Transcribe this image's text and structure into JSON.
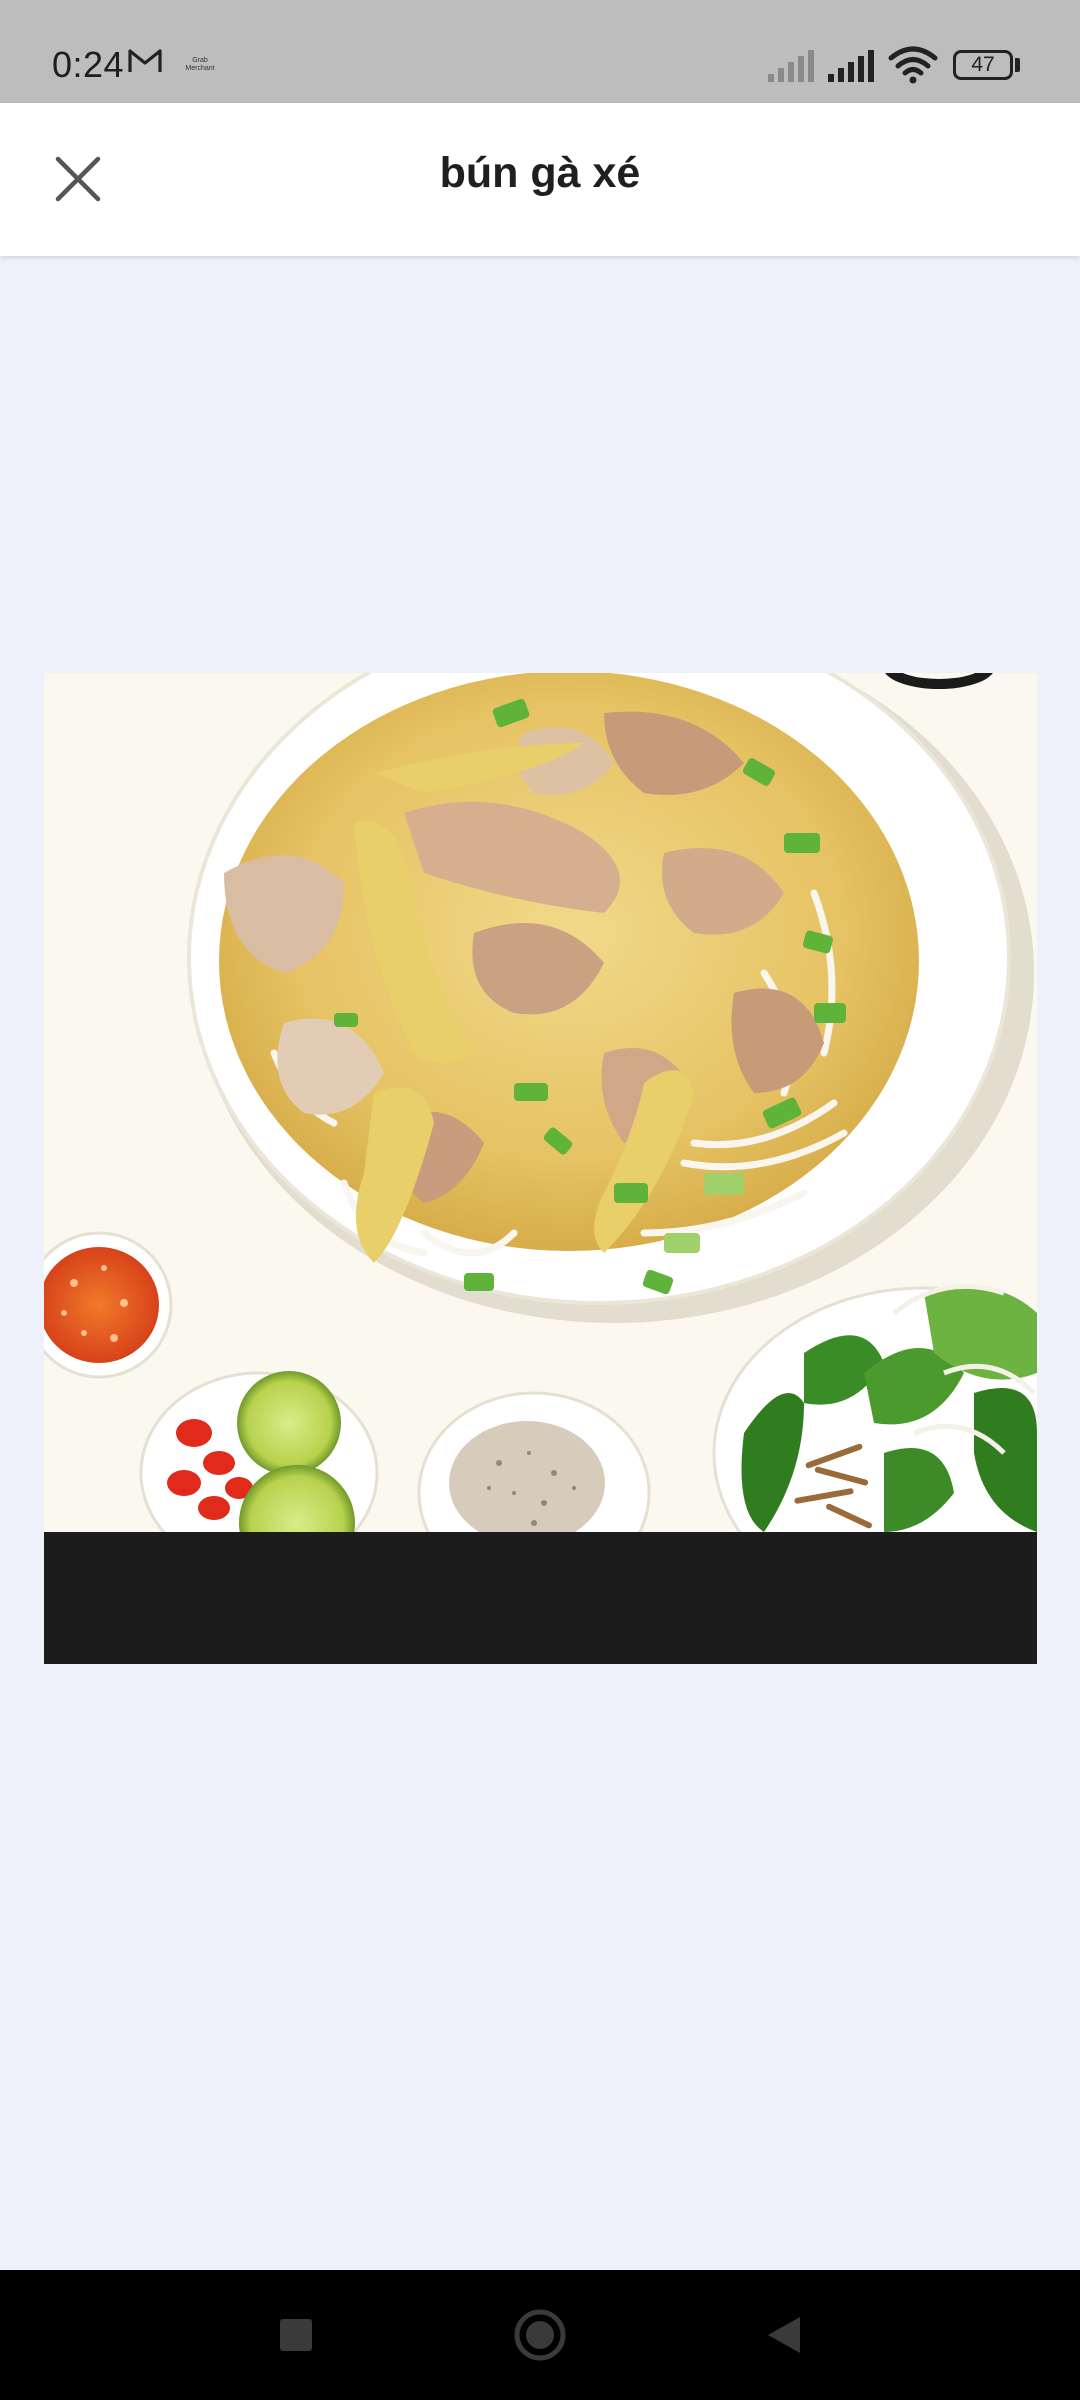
{
  "status_bar": {
    "time": "0:24",
    "app_indicator": "Grab Merchant",
    "battery_level": "47",
    "icons": [
      "gmail-icon",
      "signal-icon",
      "signal-icon",
      "wifi-icon",
      "battery-icon"
    ]
  },
  "header": {
    "title": "bún gà xé",
    "close_icon": "close-icon"
  },
  "photo": {
    "subject": "bowl of shredded chicken noodle soup with chili sauce, lime, chili, pepper salt and fresh herbs",
    "background_color": "#fbf8f0",
    "caption_band_color": "#1c1c1c"
  },
  "nav_bar": {
    "buttons": [
      "recents-square-icon",
      "home-circle-icon",
      "back-triangle-icon"
    ]
  },
  "colors": {
    "status_bar_bg": "#bdbdbd",
    "page_bg": "#eef1fa",
    "header_bg": "#ffffff",
    "nav_bar_bg": "#000000"
  }
}
